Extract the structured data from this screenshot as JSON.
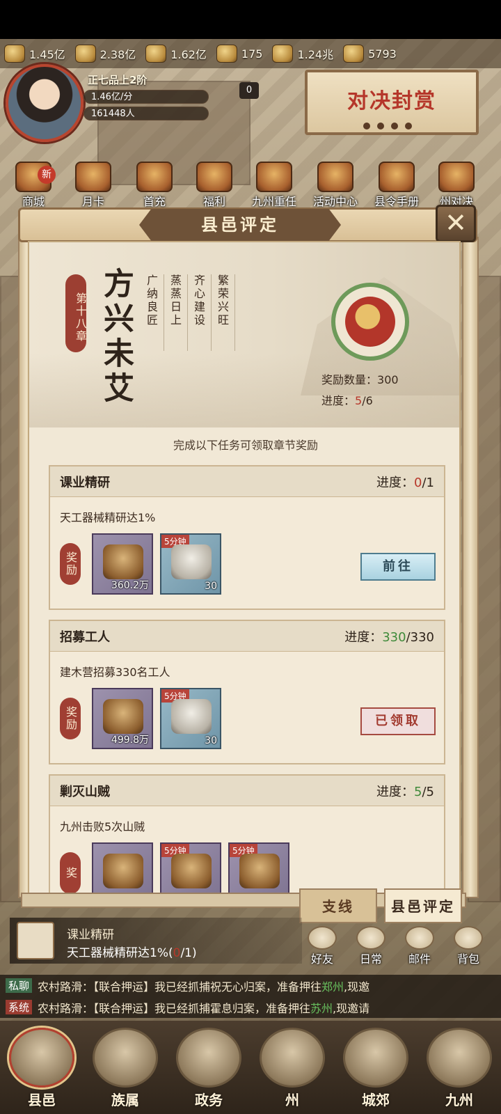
{
  "resources": [
    {
      "icon": "coin-pile-icon",
      "value": "1.45亿"
    },
    {
      "icon": "timber-icon",
      "value": "2.38亿"
    },
    {
      "icon": "grain-icon",
      "value": "1.62亿"
    },
    {
      "icon": "copper-coin-icon",
      "value": "175"
    },
    {
      "icon": "silver-coin-icon",
      "value": "1.24兆"
    },
    {
      "icon": "ingot-icon",
      "value": "5793"
    }
  ],
  "player": {
    "rank": "正七品上2阶",
    "income": "1.46亿/分",
    "population": "161448人"
  },
  "badge_count": "0",
  "duel_banner": "对决封赏",
  "top_menu": [
    {
      "icon": "shop-icon",
      "label": "商城"
    },
    {
      "icon": "month-card-icon",
      "label": "月卡"
    },
    {
      "icon": "first-charge-icon",
      "label": "首充"
    },
    {
      "icon": "welfare-icon",
      "label": "福利"
    },
    {
      "icon": "jiuzhou-task-icon",
      "label": "九州重任"
    },
    {
      "icon": "event-center-icon",
      "label": "活动中心"
    },
    {
      "icon": "magistrate-manual-icon",
      "label": "县令手册"
    },
    {
      "icon": "state-duel-icon",
      "label": "州对决"
    }
  ],
  "new_tag": "新",
  "modal": {
    "title": "县邑评定",
    "close": "✕",
    "chapter": {
      "number": "第十八章",
      "name": "方兴未艾",
      "goals": [
        "繁荣兴旺",
        "齐心建设",
        "蒸蒸日上",
        "广纳良匠"
      ],
      "reward_count_label": "奖励数量：",
      "reward_count": "300",
      "progress_label": "进度：",
      "progress_current": "5",
      "progress_total": "/6"
    },
    "hint": "完成以下任务可领取章节奖励",
    "tasks": [
      {
        "name": "课业精研",
        "progress_label": "进度：",
        "progress_current": "0",
        "progress_total": "/1",
        "desc": "天工器械精研达1%",
        "reward_label": "奖励",
        "items": [
          {
            "icon": "timber-bundle-icon",
            "qty": "360.2万",
            "time": ""
          },
          {
            "icon": "scroll-icon",
            "qty": "30",
            "time": "5分钟"
          }
        ],
        "button": "前往"
      },
      {
        "name": "招募工人",
        "progress_label": "进度：",
        "progress_current": "330",
        "progress_total": "/330",
        "desc": "建木营招募330名工人",
        "reward_label": "奖励",
        "items": [
          {
            "icon": "log-icon",
            "qty": "499.8万",
            "time": ""
          },
          {
            "icon": "hammer-icon",
            "qty": "30",
            "time": "5分钟"
          }
        ],
        "button": "已领取"
      },
      {
        "name": "剿灭山贼",
        "progress_label": "进度：",
        "progress_current": "5",
        "progress_total": "/5",
        "desc": "九州击败5次山贼",
        "reward_label": "奖",
        "items": [
          {
            "icon": "gold-bar-icon",
            "qty": "",
            "time": ""
          },
          {
            "icon": "drum-icon",
            "qty": "",
            "time": "5分钟"
          },
          {
            "icon": "helmet-icon",
            "qty": "",
            "time": "5分钟"
          }
        ]
      }
    ],
    "tabs": {
      "branch": "支线",
      "county": "县邑评定"
    }
  },
  "current_quest": {
    "title": "课业精研",
    "desc_prefix": "天工器械精研达1%(",
    "desc_current": "0",
    "desc_suffix": "/1)"
  },
  "side_buttons": [
    "好友",
    "日常",
    "邮件",
    "背包"
  ],
  "chat": [
    {
      "tag": "私聊",
      "prefix": "农村路滑：【联合押运】我已经抓捕祝无心归案，准备押往",
      "city": "郑州",
      "suffix": ",现邀"
    },
    {
      "tag": "系统",
      "prefix": "农村路滑：【联合押运】我已经抓捕霍息归案，准备押往",
      "city": "苏州",
      "suffix": ",现邀请"
    }
  ],
  "bottom_nav": [
    {
      "icon": "county-icon",
      "label": "县邑"
    },
    {
      "icon": "family-icon",
      "label": "族属"
    },
    {
      "icon": "affairs-icon",
      "label": "政务"
    },
    {
      "icon": "state-icon",
      "label": "州"
    },
    {
      "icon": "suburb-icon",
      "label": "城郊"
    },
    {
      "icon": "jiuzhou-icon",
      "label": "九州"
    }
  ]
}
